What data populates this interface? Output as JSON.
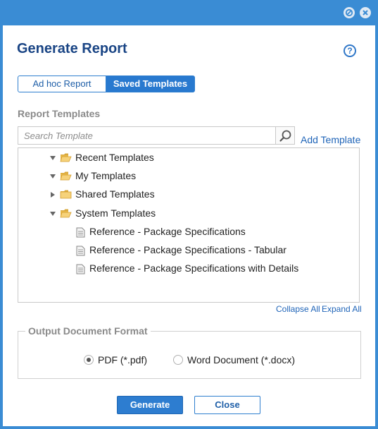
{
  "dialog": {
    "title": "Generate Report",
    "help_icon_label": "?"
  },
  "tabs": [
    {
      "label": "Ad hoc Report",
      "active": false
    },
    {
      "label": "Saved Templates",
      "active": true
    }
  ],
  "templates": {
    "section_label": "Report Templates",
    "search_placeholder": "Search Template",
    "add_template_label": "Add Template",
    "tree": [
      {
        "label": "Recent Templates",
        "expanded": true,
        "type": "folder"
      },
      {
        "label": "My Templates",
        "expanded": true,
        "type": "folder"
      },
      {
        "label": "Shared Templates",
        "expanded": false,
        "type": "folder"
      },
      {
        "label": "System Templates",
        "expanded": true,
        "type": "folder",
        "children": [
          {
            "label": "Reference - Package Specifications",
            "type": "file"
          },
          {
            "label": "Reference - Package Specifications - Tabular",
            "type": "file"
          },
          {
            "label": "Reference - Package Specifications with Details",
            "type": "file"
          }
        ]
      }
    ],
    "collapse_all_label": "Collapse All",
    "expand_all_label": "Expand All"
  },
  "output_format": {
    "legend": "Output Document Format",
    "options": [
      {
        "label": "PDF (*.pdf)",
        "selected": true
      },
      {
        "label": "Word Document (*.docx)",
        "selected": false
      }
    ]
  },
  "buttons": {
    "generate_label": "Generate",
    "close_label": "Close"
  },
  "colors": {
    "frame": "#3a8cd4",
    "title": "#1a4585",
    "accent": "#2879cf",
    "link": "#1f64b8"
  }
}
